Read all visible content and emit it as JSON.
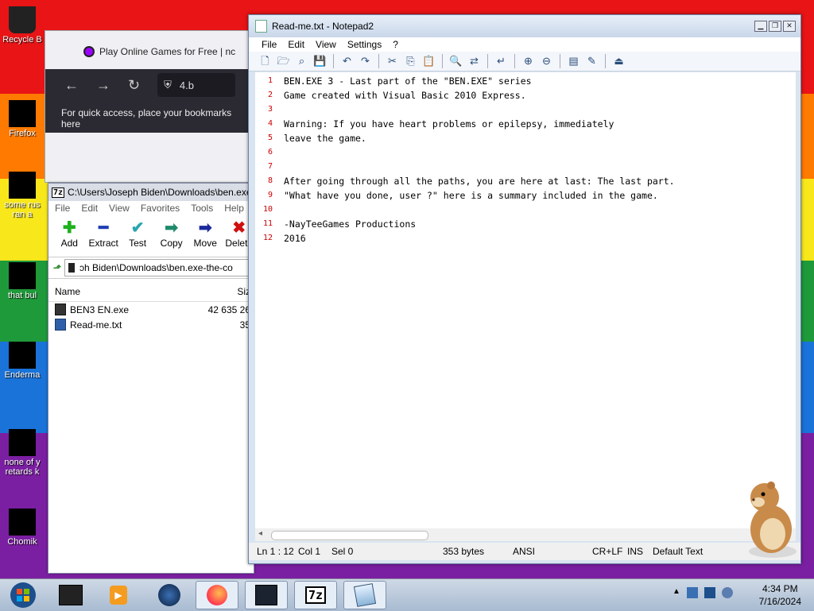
{
  "desktop": {
    "icons": [
      {
        "label": "Recycle B",
        "label2": ""
      },
      {
        "label": "Firefox",
        "label2": ""
      },
      {
        "label": "some rus",
        "label2": "ran a"
      },
      {
        "label": "that bul",
        "label2": ""
      },
      {
        "label": "Enderma",
        "label2": ""
      },
      {
        "label": "none of y",
        "label2": "retards k"
      },
      {
        "label": "Chomik",
        "label2": ""
      }
    ]
  },
  "browser": {
    "tab_title": "Play Online Games for Free | nc",
    "url_fragment": "4.b",
    "bookmarks_hint": "For quick access, place your bookmarks here"
  },
  "zip": {
    "title": "C:\\Users\\Joseph Biden\\Downloads\\ben.exe",
    "menu": [
      "File",
      "Edit",
      "View",
      "Favorites",
      "Tools",
      "Help"
    ],
    "toolbar": [
      {
        "label": "Add",
        "icon": "plus-icon",
        "glyph": "✚",
        "color": "#1db11d"
      },
      {
        "label": "Extract",
        "icon": "minus-icon",
        "glyph": "━",
        "color": "#1f3fb5"
      },
      {
        "label": "Test",
        "icon": "check-icon",
        "glyph": "✔",
        "color": "#2aa6b0"
      },
      {
        "label": "Copy",
        "icon": "arrow-right-icon",
        "glyph": "➡",
        "color": "#1e8a6a"
      },
      {
        "label": "Move",
        "icon": "arrow-right-icon",
        "glyph": "➡",
        "color": "#1c2a9c"
      },
      {
        "label": "Delete",
        "icon": "delete-x-icon",
        "glyph": "✖",
        "color": "#d01010"
      }
    ],
    "path": "ɔh Biden\\Downloads\\ben.exe-the-co",
    "columns": {
      "name": "Name",
      "size": "Siz"
    },
    "files": [
      {
        "name": "BEN3 EN.exe",
        "size": "42 635 26"
      },
      {
        "name": "Read-me.txt",
        "size": "35"
      }
    ]
  },
  "notepad": {
    "title": "Read-me.txt - Notepad2",
    "menu": [
      "File",
      "Edit",
      "View",
      "Settings",
      "?"
    ],
    "lines": [
      {
        "n": "1",
        "text": "BEN.EXE 3 - Last part of the \"BEN.EXE\" series"
      },
      {
        "n": "2",
        "text": "Game created with Visual Basic 2010 Express."
      },
      {
        "n": "3",
        "text": ""
      },
      {
        "n": "4",
        "text": "Warning: If you have heart problems or epilepsy, immediately"
      },
      {
        "n": "5",
        "text": "leave the game."
      },
      {
        "n": "6",
        "text": ""
      },
      {
        "n": "7",
        "text": ""
      },
      {
        "n": "8",
        "text": "After going through all the paths, you are here at last: The last part."
      },
      {
        "n": "9",
        "text": "\"What have you done, user ?\" here is a summary included in the game."
      },
      {
        "n": "10",
        "text": ""
      },
      {
        "n": "11",
        "text": "-NayTeeGames Productions"
      },
      {
        "n": "12",
        "text": "2016"
      }
    ],
    "status": {
      "position": "Ln 1 : 12",
      "col": "Col 1",
      "sel": "Sel 0",
      "size": "353 bytes",
      "encoding": "ANSI",
      "eol": "CR+LF",
      "mode": "INS",
      "scheme": "Default Text"
    }
  },
  "taskbar": {
    "time": "4:34 PM",
    "date": "7/16/2024",
    "zip_label": "7z"
  }
}
